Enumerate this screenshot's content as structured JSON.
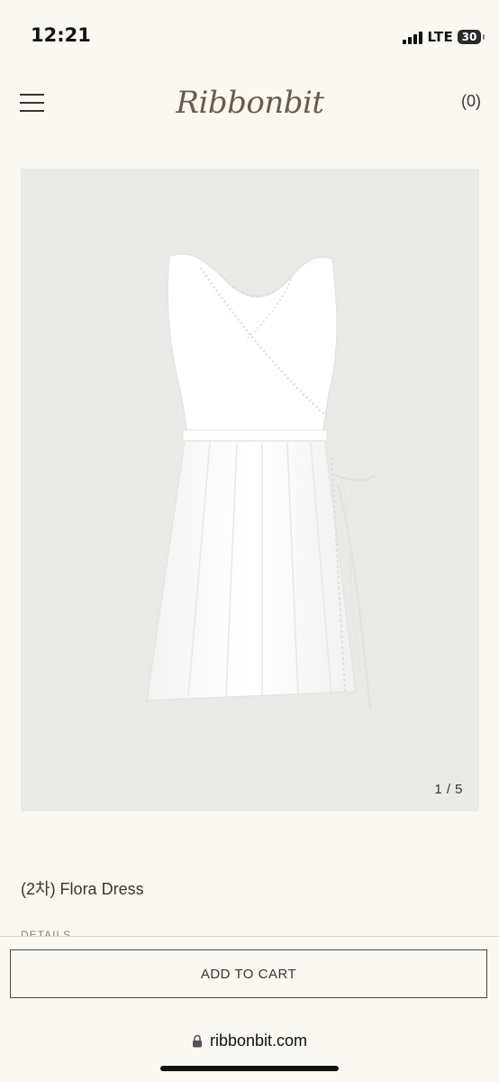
{
  "status_bar": {
    "time": "12:21",
    "network": "LTE",
    "battery": "30"
  },
  "header": {
    "menu_icon": "hamburger-menu-icon",
    "brand": "Ribbonbit",
    "cart_count": "(0)"
  },
  "gallery": {
    "image_subject": "white sleeveless wrap dress with pleated skirt",
    "counter": "1 / 5"
  },
  "product": {
    "title": "(2차) Flora Dress",
    "details_label": "DETAILS"
  },
  "cart_bar": {
    "add_to_cart_label": "ADD TO CART"
  },
  "browser": {
    "url": "ribbonbit.com",
    "lock_icon": "lock-icon"
  },
  "colors": {
    "page_background": "#fbf8f2",
    "gallery_background": "#ebeae7",
    "text": "#3a3530",
    "brand": "#6e5a48"
  }
}
